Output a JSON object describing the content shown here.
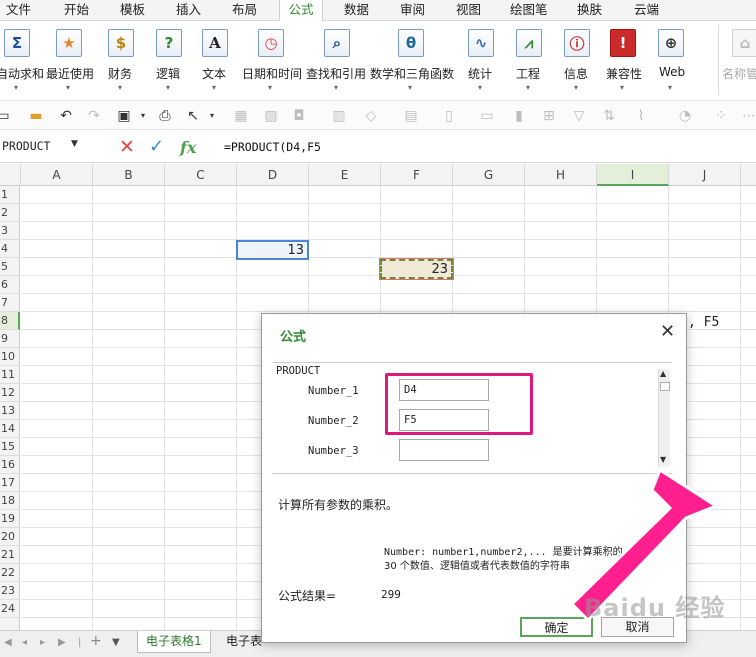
{
  "menu": {
    "tabs": [
      {
        "label": "文件"
      },
      {
        "label": "开始"
      },
      {
        "label": "模板"
      },
      {
        "label": "插入"
      },
      {
        "label": "布局"
      },
      {
        "label": "公式"
      },
      {
        "label": "数据"
      },
      {
        "label": "审阅"
      },
      {
        "label": "视图"
      },
      {
        "label": "绘图笔"
      },
      {
        "label": "换肤"
      },
      {
        "label": "云端"
      }
    ],
    "active_tab": "公式"
  },
  "ribbon": {
    "groups": [
      {
        "label": "自动求和",
        "icon": "sigma-icon",
        "glyph": "Σ"
      },
      {
        "label": "最近使用",
        "icon": "star-icon",
        "glyph": "★"
      },
      {
        "label": "财务",
        "icon": "money-bag-icon",
        "glyph": "$"
      },
      {
        "label": "逻辑",
        "icon": "question-icon",
        "glyph": "?"
      },
      {
        "label": "文本",
        "icon": "text-a-icon",
        "glyph": "A"
      },
      {
        "label": "日期和时间",
        "icon": "clock-icon",
        "glyph": "◷"
      },
      {
        "label": "查找和引用",
        "icon": "magnifier-icon",
        "glyph": "⌕"
      },
      {
        "label": "数学和三角函数",
        "icon": "theta-icon",
        "glyph": "θ"
      },
      {
        "label": "统计",
        "icon": "line-chart-icon",
        "glyph": "∿"
      },
      {
        "label": "工程",
        "icon": "compass-icon",
        "glyph": "⩘"
      },
      {
        "label": "信息",
        "icon": "info-icon",
        "glyph": "ⓘ"
      },
      {
        "label": "兼容性",
        "icon": "warning-icon",
        "glyph": "!"
      },
      {
        "label": "Web",
        "icon": "globe-icon",
        "glyph": "⊕"
      }
    ],
    "name_manager_label": "名称管"
  },
  "formula_bar": {
    "name_box": "PRODUCT",
    "formula": "=PRODUCT(D4,F5"
  },
  "columns": [
    "A",
    "B",
    "C",
    "D",
    "E",
    "F",
    "G",
    "H",
    "I",
    "J"
  ],
  "selected_column": "I",
  "rows": [
    "1",
    "2",
    "3",
    "4",
    "5",
    "6",
    "7",
    "8",
    "9",
    "10",
    "11",
    "12",
    "13",
    "14",
    "15",
    "16",
    "17",
    "18",
    "19",
    "20",
    "21",
    "22",
    "23",
    "24"
  ],
  "selected_row": "8",
  "cells": {
    "d4": "13",
    "f5": "23",
    "row8_overflow": ", F5"
  },
  "sheets": {
    "tabs": [
      "电子表格1",
      "电子表"
    ],
    "active": "电子表格1"
  },
  "dialog": {
    "title": "公式",
    "function_name": "PRODUCT",
    "args": [
      {
        "label": "Number_1",
        "value": "D4"
      },
      {
        "label": "Number_2",
        "value": "F5"
      },
      {
        "label": "Number_3",
        "value": ""
      }
    ],
    "description": "计算所有参数的乘积。",
    "help_line1": "Number: number1,number2,... 是要计算乘积的 1 到",
    "help_line2": "30 个数值、逻辑值或者代表数值的字符串",
    "result_label": "公式结果=",
    "result_value": "299",
    "ok_label": "确定",
    "cancel_label": "取消"
  },
  "colors": {
    "accent_green": "#2f8a2f",
    "highlight_pink": "#e0197f",
    "selection_blue": "#4a86d4"
  },
  "watermark": "Baidu 经验"
}
